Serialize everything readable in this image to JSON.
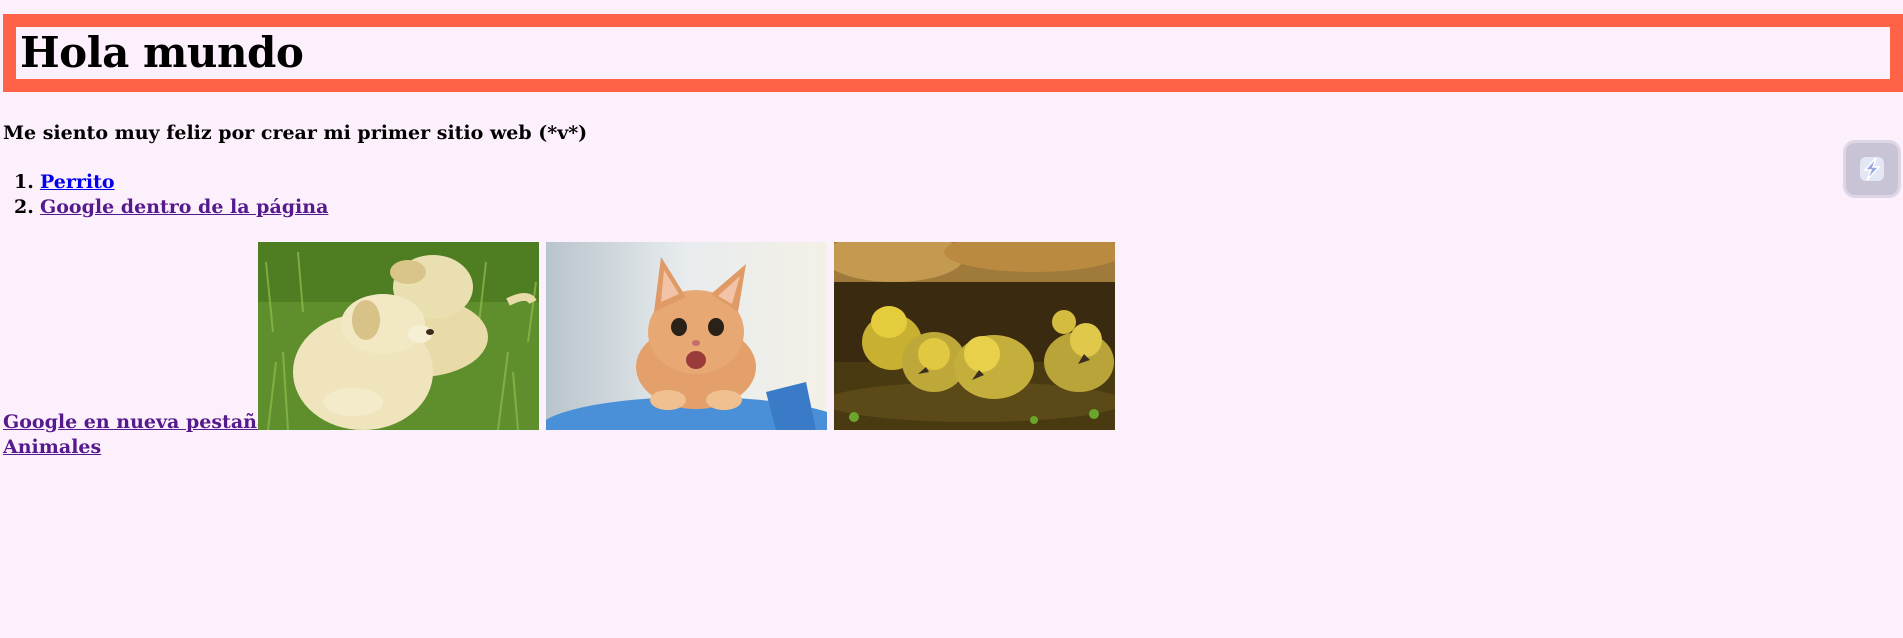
{
  "header": {
    "title": "Hola mundo"
  },
  "intro_text": "Me siento muy feliz por crear mi primer sitio web (*v*)",
  "ordered_links": [
    {
      "number": "1.",
      "label": "Perrito"
    },
    {
      "number": "2.",
      "label": "Google dentro de la página"
    }
  ],
  "bottom_links": {
    "google_new_tab": "Google en nueva pestaña",
    "animals": "Animales"
  },
  "images": [
    "puppies-photo",
    "kitten-photo",
    "ducklings-photo"
  ],
  "extension_button": {
    "icon": "lightning-bolt-icon"
  },
  "colors": {
    "background": "#fdf0fd",
    "title_border": "#ff6347",
    "link_unvisited": "#0000ee",
    "link_visited": "#551a8b"
  }
}
